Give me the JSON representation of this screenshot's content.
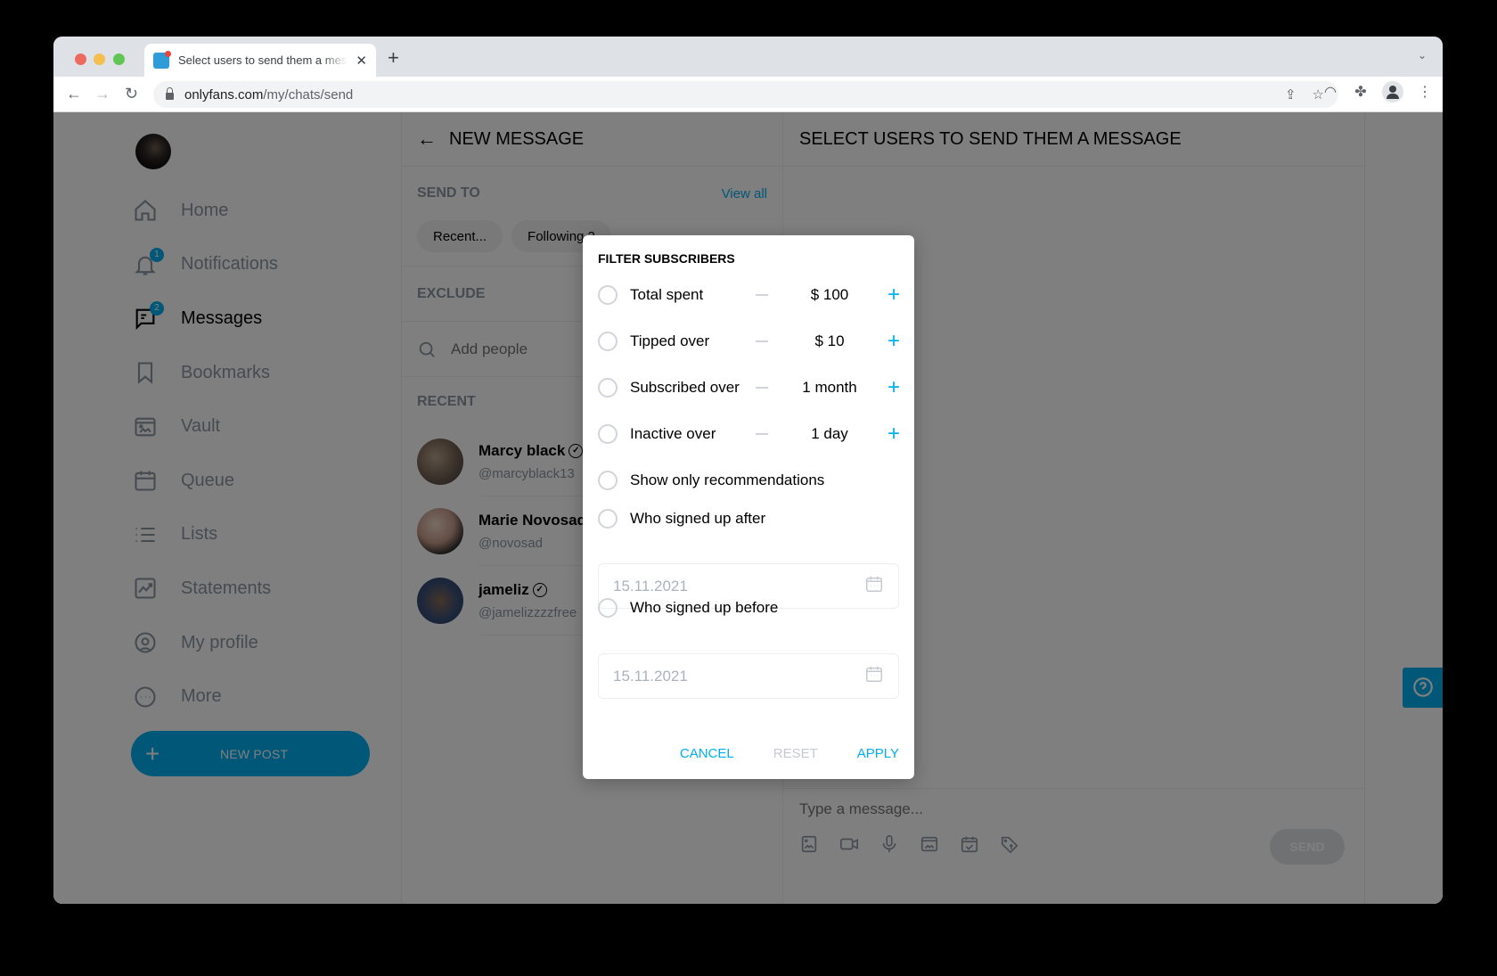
{
  "browser": {
    "tab_title": "Select users to send them a message",
    "url_domain": "onlyfans.com",
    "url_path": "/my/chats/send"
  },
  "sidebar": {
    "items": [
      {
        "label": "Home",
        "icon": "home-icon",
        "active": false
      },
      {
        "label": "Notifications",
        "icon": "bell-icon",
        "badge": "1",
        "active": false
      },
      {
        "label": "Messages",
        "icon": "message-icon",
        "badge": "2",
        "active": true
      },
      {
        "label": "Bookmarks",
        "icon": "bookmark-icon",
        "active": false
      },
      {
        "label": "Vault",
        "icon": "vault-icon",
        "active": false
      },
      {
        "label": "Queue",
        "icon": "calendar-icon",
        "active": false
      },
      {
        "label": "Lists",
        "icon": "list-icon",
        "active": false
      },
      {
        "label": "Statements",
        "icon": "chart-icon",
        "active": false
      },
      {
        "label": "My profile",
        "icon": "profile-icon",
        "active": false
      },
      {
        "label": "More",
        "icon": "more-icon",
        "active": false
      }
    ],
    "new_post_label": "NEW POST"
  },
  "middle": {
    "title": "NEW MESSAGE",
    "send_to_label": "SEND TO",
    "view_all_label": "View all",
    "chips": [
      "Recent...",
      "Following 2"
    ],
    "exclude_label": "EXCLUDE",
    "add_people_placeholder": "Add people",
    "recent_label": "RECENT",
    "recent_users": [
      {
        "name": "Marcy black",
        "handle": "@marcyblack13",
        "verified": true
      },
      {
        "name": "Marie Novosad",
        "handle": "@novosad",
        "verified": false
      },
      {
        "name": "jameliz",
        "handle": "@jamelizzzzfree",
        "verified": true
      }
    ]
  },
  "right": {
    "title": "SELECT USERS TO SEND THEM A MESSAGE",
    "message_placeholder": "Type a message...",
    "send_label": "SEND"
  },
  "dialog": {
    "title": "FILTER SUBSCRIBERS",
    "filters": [
      {
        "label": "Total spent",
        "value": "$ 100"
      },
      {
        "label": "Tipped over",
        "value": "$ 10"
      },
      {
        "label": "Subscribed over",
        "value": "1 month"
      },
      {
        "label": "Inactive over",
        "value": "1 day"
      }
    ],
    "recommendations_label": "Show only recommendations",
    "signed_after_label": "Who signed up after",
    "signed_after_date": "15.11.2021",
    "signed_before_label": "Who signed up before",
    "signed_before_date": "15.11.2021",
    "cancel_label": "CANCEL",
    "reset_label": "RESET",
    "apply_label": "APPLY"
  },
  "colors": {
    "accent": "#00aff0",
    "overlay": "rgba(0,0,0,0.5)"
  }
}
